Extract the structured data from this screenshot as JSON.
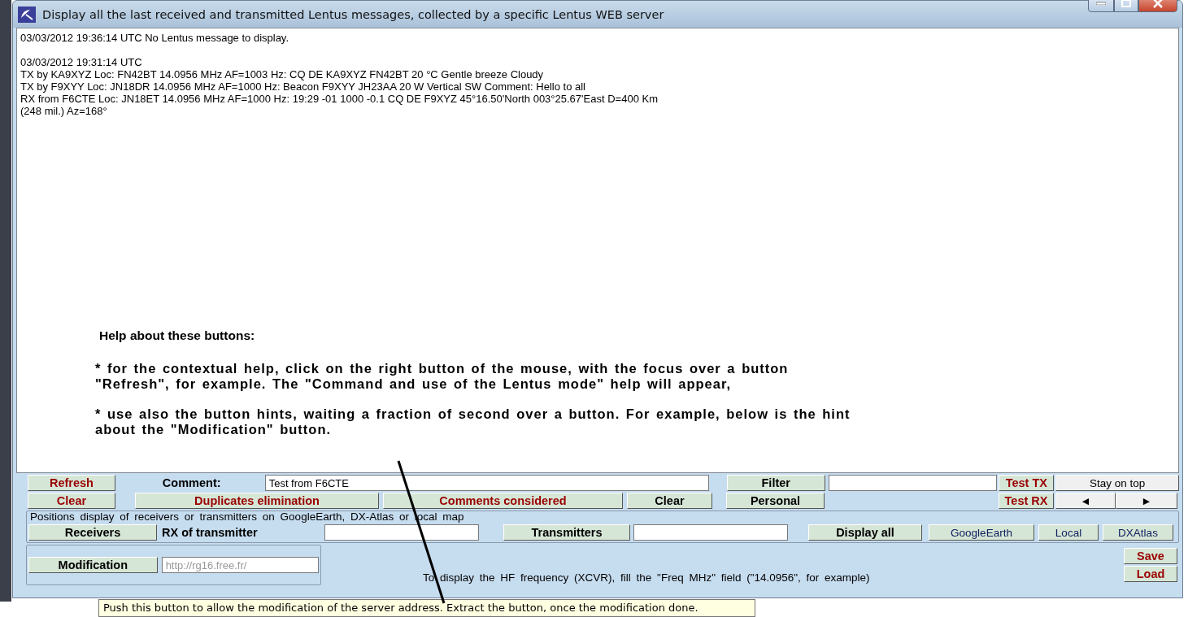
{
  "window": {
    "title": "Display all the last received and transmitted Lentus messages, collected by a specific Lentus WEB server"
  },
  "messages": [
    {
      "kind": "line",
      "text": "03/03/2012 19:36:14 UTC   No Lentus message to display."
    },
    {
      "kind": "blank"
    },
    {
      "kind": "line",
      "text": "03/03/2012 19:31:14 UTC"
    },
    {
      "kind": "line",
      "text": "TX by KA9XYZ Loc: FN42BT 14.0956 MHz AF=1003 Hz: CQ DE KA9XYZ FN42BT 20 °C Gentle breeze Cloudy"
    },
    {
      "kind": "line",
      "text": "TX by F9XYY Loc: JN18DR 14.0956 MHz AF=1000 Hz: Beacon F9XYY JH23AA 20 W Vertical SW Comment: Hello to all"
    },
    {
      "kind": "line",
      "text": "RX from F6CTE Loc: JN18ET 14.0956 MHz AF=1000 Hz: 19:29 -01 1000 -0.1 CQ DE F9XYZ 45°16.50'North 003°25.67'East D=400 Km"
    },
    {
      "kind": "line",
      "text": "(248 mil.) Az=168°"
    }
  ],
  "help": {
    "heading": "Help about these buttons:",
    "paragraphs": [
      " * for the contextual help, click on the right button of the mouse, with the focus over a button \"Refresh\", for example. The \"Command and use of the Lentus mode\" help will appear,",
      " * use also the button hints, waiting a fraction of second over a button. For example, below is the hint about the \"Modification\" button."
    ]
  },
  "controls": {
    "refresh": "Refresh",
    "comment_label": "Comment:",
    "comment_value": "Test from F6CTE",
    "filter": "Filter",
    "test_tx": "Test TX",
    "stay_on_top": "Stay on top",
    "clear": "Clear",
    "duplicates": "Duplicates elimination",
    "comments_considered": "Comments considered",
    "clear_2": "Clear",
    "personal": "Personal",
    "test_rx": "Test RX",
    "prev": "◄",
    "next": "►",
    "positions_legend": "Positions display of receivers or transmitters on GoogleEarth, DX-Atlas or local map",
    "receivers": "Receivers",
    "rx_label": "RX of transmitter",
    "transmitters": "Transmitters",
    "display_all": "Display all",
    "google_earth": "GoogleEarth",
    "local": "Local",
    "dxatlas": "DXAtlas",
    "modification": "Modification",
    "server_url": "http://rg16.free.fr/",
    "info": "To display the HF frequency (XCVR), fill the \"Freq MHz\" field (\"14.0956\", for example)",
    "save": "Save",
    "load": "Load"
  },
  "tooltip": "Push this button to allow the modification of the server address. Extract the button, once the modification done."
}
